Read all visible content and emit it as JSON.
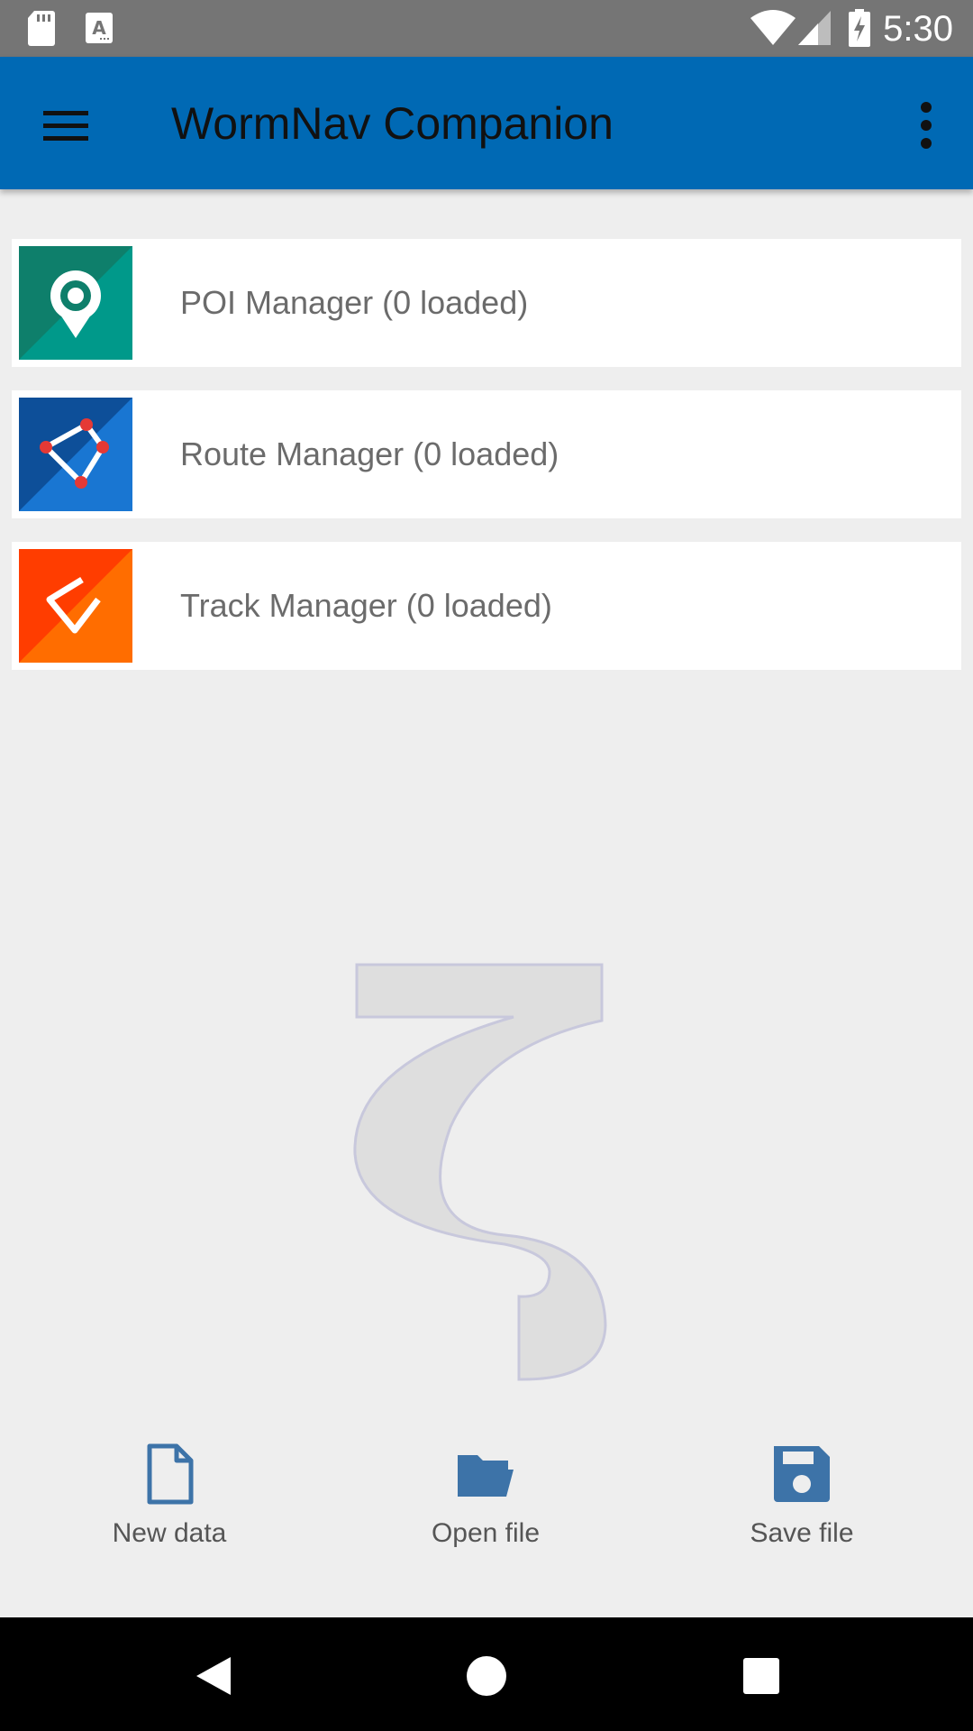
{
  "status_bar": {
    "time": "5:30",
    "icons": [
      "sd-card-icon",
      "keyboard-a-icon",
      "wifi-icon",
      "signal-icon",
      "battery-charging-icon"
    ]
  },
  "app_bar": {
    "title": "WormNav Companion",
    "left_icon": "menu-icon",
    "right_icon": "more-vert-icon",
    "color": "#0069b4"
  },
  "managers": [
    {
      "label": "POI Manager (0 loaded)",
      "icon": "poi-icon",
      "colors": [
        "#0e7f6b",
        "#00998a"
      ]
    },
    {
      "label": "Route Manager (0 loaded)",
      "icon": "route-icon",
      "colors": [
        "#0d4f99",
        "#1976d2"
      ]
    },
    {
      "label": "Track Manager (0 loaded)",
      "icon": "track-icon",
      "colors": [
        "#ff3d00",
        "#ff6d00"
      ]
    }
  ],
  "actions": [
    {
      "label": "New data",
      "icon": "new-file-icon"
    },
    {
      "label": "Open file",
      "icon": "folder-open-icon"
    },
    {
      "label": "Save file",
      "icon": "save-icon"
    }
  ],
  "action_color": "#3d73a8",
  "nav_bar": {
    "icons": [
      "back-icon",
      "home-icon",
      "recents-icon"
    ]
  }
}
